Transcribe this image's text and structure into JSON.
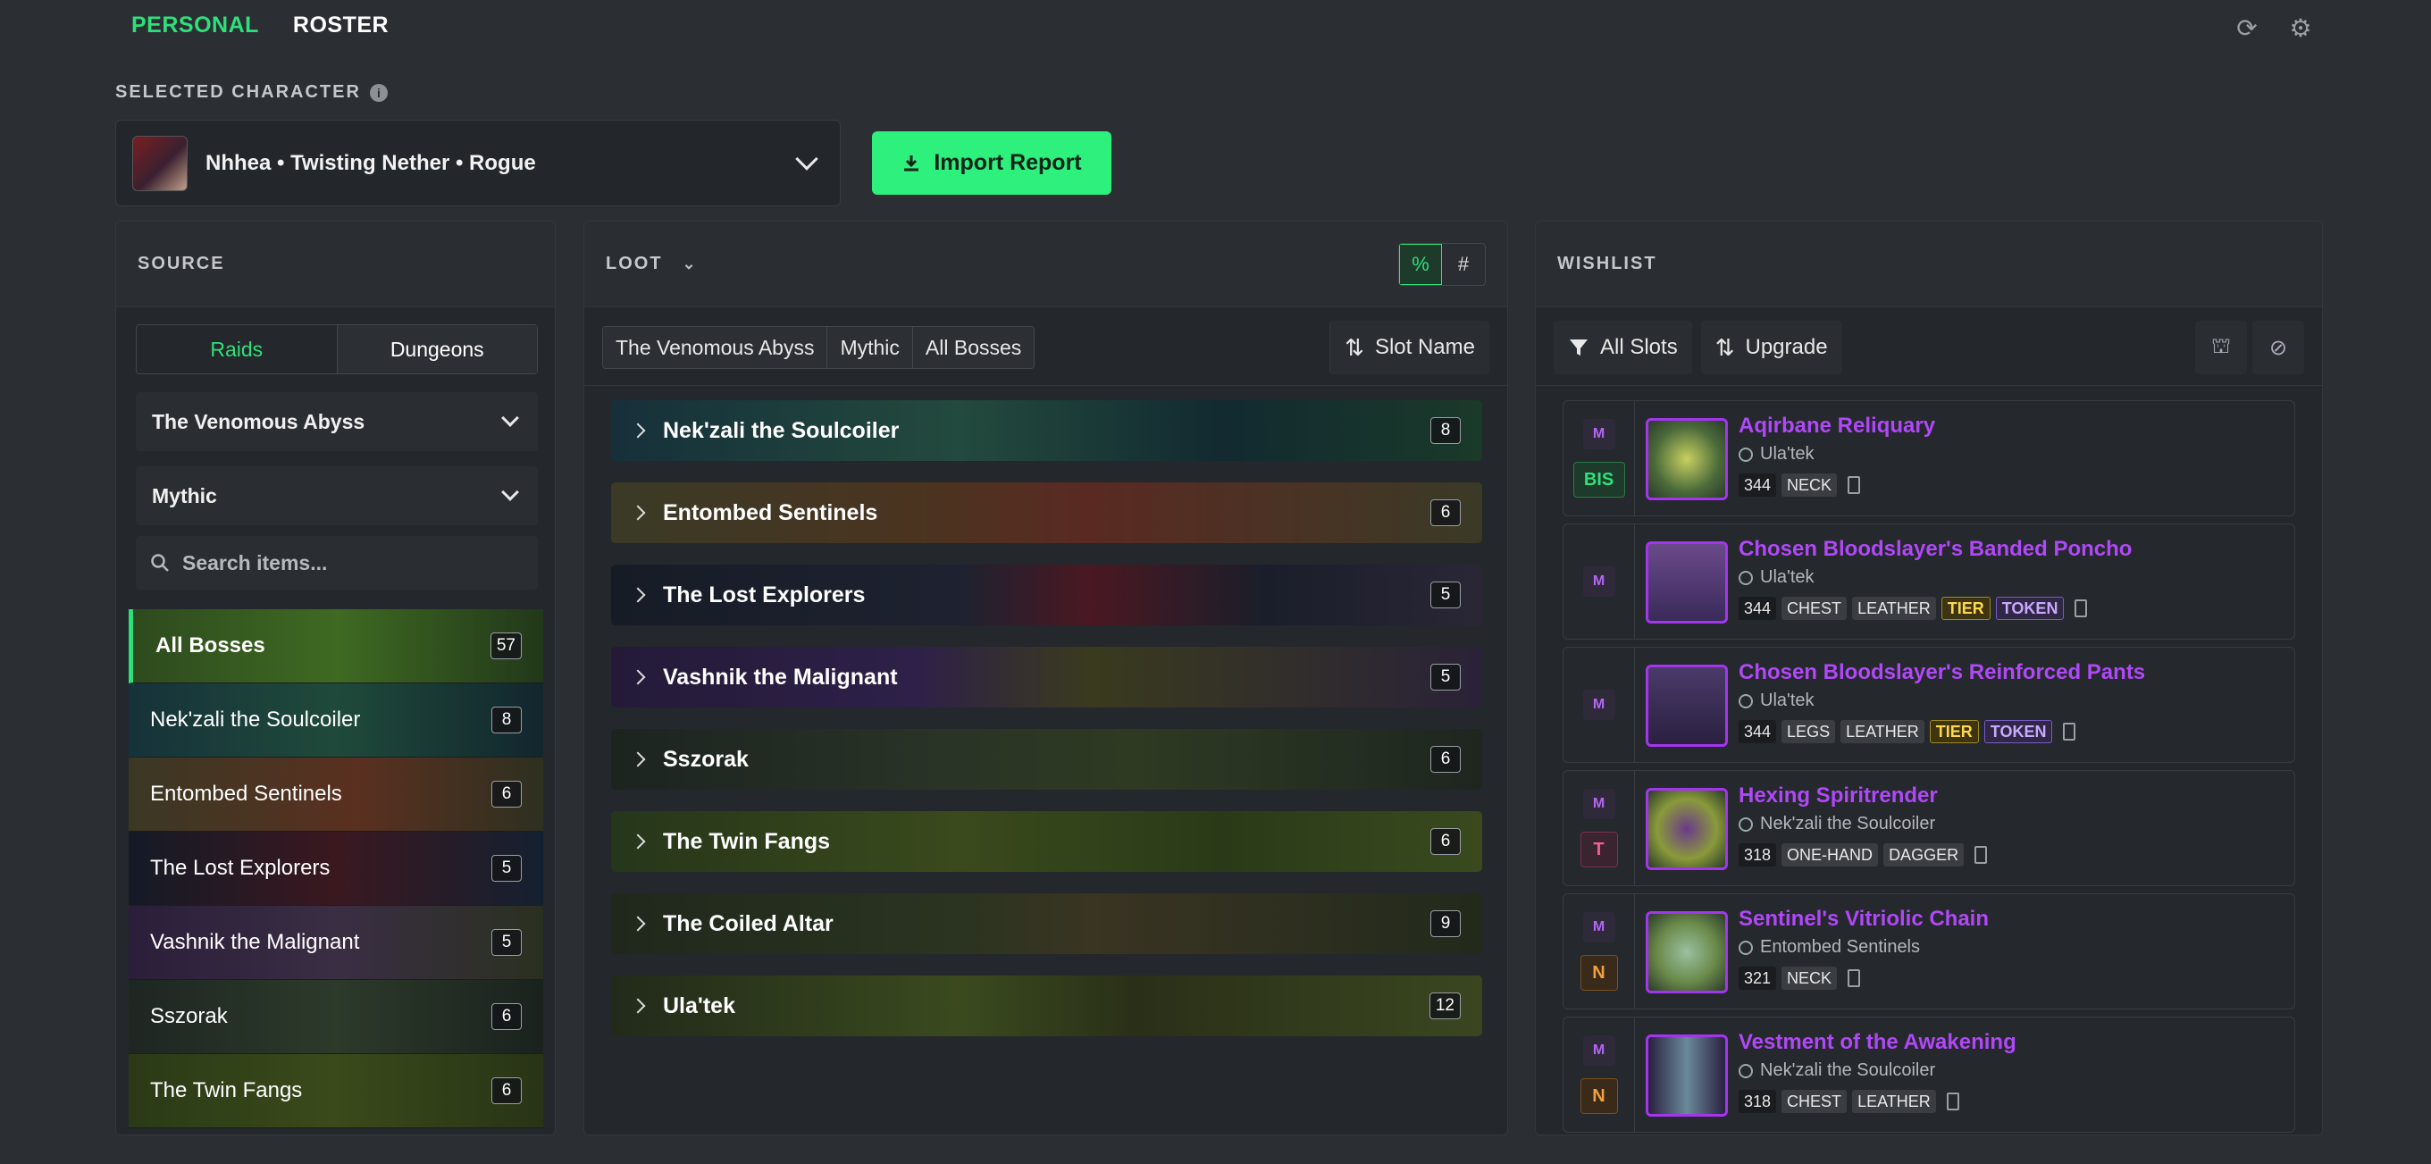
{
  "nav": {
    "personal": "PERSONAL",
    "roster": "ROSTER"
  },
  "selected": {
    "label": "SELECTED CHARACTER",
    "character": "Nhhea • Twisting Nether • Rogue"
  },
  "import_label": "Import Report",
  "source": {
    "title": "SOURCE",
    "tabs": [
      "Raids",
      "Dungeons"
    ],
    "instance": "The Venomous Abyss",
    "difficulty": "Mythic",
    "search_placeholder": "Search items...",
    "bosses": [
      {
        "name": "All Bosses",
        "count": "57"
      },
      {
        "name": "Nek'zali the Soulcoiler",
        "count": "8"
      },
      {
        "name": "Entombed Sentinels",
        "count": "6"
      },
      {
        "name": "The Lost Explorers",
        "count": "5"
      },
      {
        "name": "Vashnik the Malignant",
        "count": "5"
      },
      {
        "name": "Sszorak",
        "count": "6"
      },
      {
        "name": "The Twin Fangs",
        "count": "6"
      }
    ]
  },
  "loot": {
    "title": "LOOT",
    "toggle": [
      "%",
      "#"
    ],
    "filters": [
      "The Venomous Abyss",
      "Mythic",
      "All Bosses"
    ],
    "sort": "Slot Name",
    "rows": [
      {
        "name": "Nek'zali the Soulcoiler",
        "count": "8"
      },
      {
        "name": "Entombed Sentinels",
        "count": "6"
      },
      {
        "name": "The Lost Explorers",
        "count": "5"
      },
      {
        "name": "Vashnik the Malignant",
        "count": "5"
      },
      {
        "name": "Sszorak",
        "count": "6"
      },
      {
        "name": "The Twin Fangs",
        "count": "6"
      },
      {
        "name": "The Coiled Altar",
        "count": "9"
      },
      {
        "name": "Ula'tek",
        "count": "12"
      }
    ]
  },
  "wishlist": {
    "title": "WISHLIST",
    "filter": "All Slots",
    "sort": "Upgrade",
    "items": [
      {
        "badges": [
          "M",
          "BIS"
        ],
        "name": "Aqirbane Reliquary",
        "source": "Ula'tek",
        "tags": [
          "344",
          "NECK"
        ]
      },
      {
        "badges": [
          "M"
        ],
        "name": "Chosen Bloodslayer's Banded Poncho",
        "source": "Ula'tek",
        "tags": [
          "344",
          "CHEST",
          "LEATHER",
          "TIER",
          "TOKEN"
        ]
      },
      {
        "badges": [
          "M"
        ],
        "name": "Chosen Bloodslayer's Reinforced Pants",
        "source": "Ula'tek",
        "tags": [
          "344",
          "LEGS",
          "LEATHER",
          "TIER",
          "TOKEN"
        ]
      },
      {
        "badges": [
          "M",
          "T"
        ],
        "name": "Hexing Spiritrender",
        "source": "Nek'zali the Soulcoiler",
        "tags": [
          "318",
          "ONE-HAND",
          "DAGGER"
        ]
      },
      {
        "badges": [
          "M",
          "N"
        ],
        "name": "Sentinel's Vitriolic Chain",
        "source": "Entombed Sentinels",
        "tags": [
          "321",
          "NECK"
        ]
      },
      {
        "badges": [
          "M",
          "N"
        ],
        "name": "Vestment of the Awakening",
        "source": "Nek'zali the Soulcoiler",
        "tags": [
          "318",
          "CHEST",
          "LEATHER"
        ]
      }
    ]
  },
  "colors": {
    "accent": "#2ee07a",
    "epic": "#b048f8",
    "tier": "#ffd84a"
  }
}
